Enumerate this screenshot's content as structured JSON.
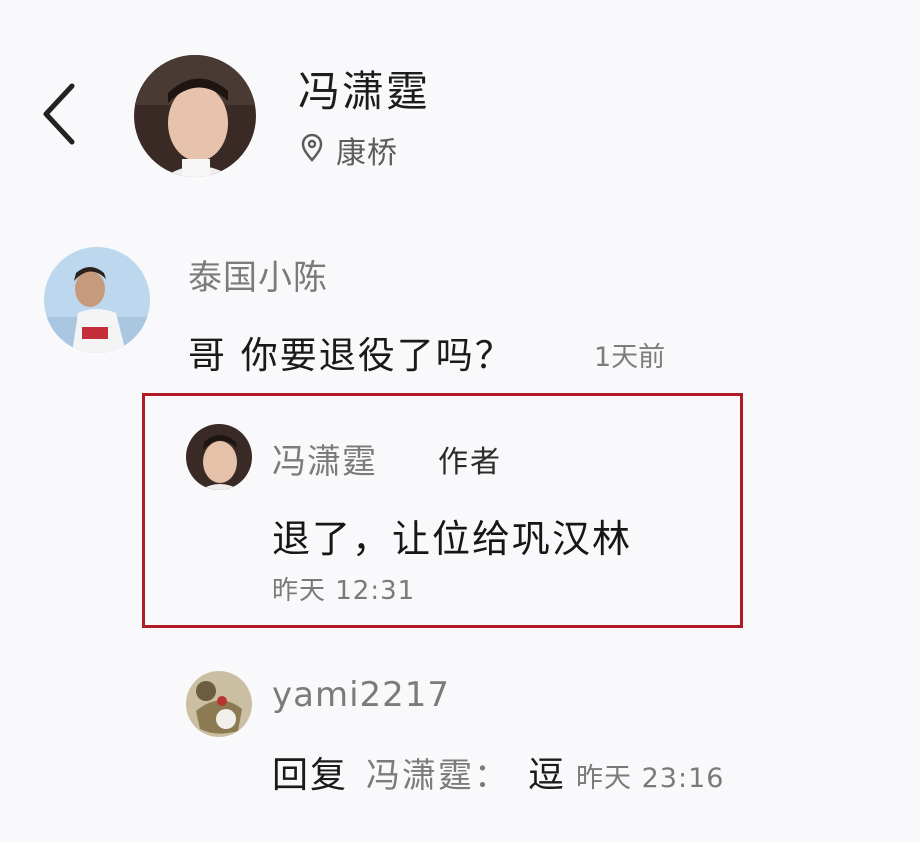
{
  "header": {
    "back_icon": "chevron-left-icon",
    "user_name": "冯潇霆",
    "location_icon": "location-pin-icon",
    "location": "康桥"
  },
  "comment": {
    "author": "泰国小陈",
    "text": "哥 你要退役了吗？",
    "time": "1天前"
  },
  "author_reply": {
    "author": "冯潇霆",
    "badge": "作者",
    "text": "退了，让位给巩汉林",
    "time": "昨天 12:31",
    "highlight_color": "#b01b26"
  },
  "second_reply": {
    "author": "yami2217",
    "reply_label": "回复",
    "reply_target": "冯潇霆：",
    "text": "逗",
    "time": "昨天 23:16"
  }
}
